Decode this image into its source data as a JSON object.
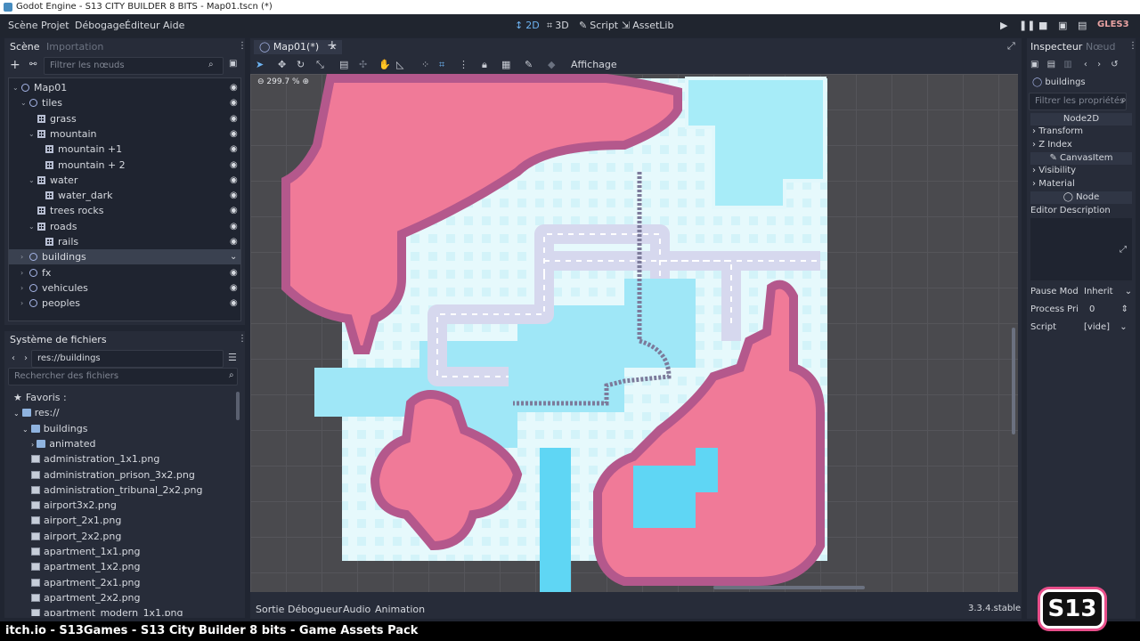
{
  "window": {
    "title": "Godot Engine - S13 CITY BUILDER 8 BITS - Map01.tscn (*)"
  },
  "menu": {
    "items": [
      "Scène",
      "Projet",
      "Débogage",
      "Éditeur",
      "Aide"
    ]
  },
  "modes": {
    "m2d": "2D",
    "m3d": "3D",
    "script": "Script",
    "assetlib": "AssetLib"
  },
  "renderer": "GLES3",
  "scene_dock": {
    "tab_active": "Scène",
    "tab_inactive": "Importation",
    "filter_placeholder": "Filtrer les nœuds",
    "tree": [
      {
        "label": "Map01",
        "type": "node2d",
        "depth": 0,
        "arrow": "open"
      },
      {
        "label": "tiles",
        "type": "node2d",
        "depth": 1,
        "arrow": "open"
      },
      {
        "label": "grass",
        "type": "tilemap",
        "depth": 2,
        "arrow": "none"
      },
      {
        "label": "mountain",
        "type": "tilemap",
        "depth": 2,
        "arrow": "open"
      },
      {
        "label": "mountain +1",
        "type": "tilemap",
        "depth": 3,
        "arrow": "none"
      },
      {
        "label": "mountain + 2",
        "type": "tilemap",
        "depth": 3,
        "arrow": "none"
      },
      {
        "label": "water",
        "type": "tilemap",
        "depth": 2,
        "arrow": "open"
      },
      {
        "label": "water_dark",
        "type": "tilemap",
        "depth": 3,
        "arrow": "none"
      },
      {
        "label": "trees rocks",
        "type": "tilemap",
        "depth": 2,
        "arrow": "none"
      },
      {
        "label": "roads",
        "type": "tilemap",
        "depth": 2,
        "arrow": "open"
      },
      {
        "label": "rails",
        "type": "tilemap",
        "depth": 3,
        "arrow": "none"
      },
      {
        "label": "buildings",
        "type": "node2d",
        "depth": 1,
        "arrow": "closed",
        "selected": true
      },
      {
        "label": "fx",
        "type": "node2d",
        "depth": 1,
        "arrow": "closed"
      },
      {
        "label": "vehicules",
        "type": "node2d",
        "depth": 1,
        "arrow": "closed"
      },
      {
        "label": "peoples",
        "type": "node2d",
        "depth": 1,
        "arrow": "closed"
      }
    ]
  },
  "filesystem": {
    "title": "Système de fichiers",
    "path": "res://buildings",
    "search_placeholder": "Rechercher des fichiers",
    "entries": [
      {
        "label": "Favoris :",
        "kind": "fav",
        "depth": 0
      },
      {
        "label": "res://",
        "kind": "folder",
        "depth": 0
      },
      {
        "label": "buildings",
        "kind": "folder",
        "depth": 1
      },
      {
        "label": "animated",
        "kind": "folder",
        "depth": 2
      },
      {
        "label": "administration_1x1.png",
        "kind": "img",
        "depth": 2
      },
      {
        "label": "administration_prison_3x2.png",
        "kind": "img",
        "depth": 2
      },
      {
        "label": "administration_tribunal_2x2.png",
        "kind": "img",
        "depth": 2
      },
      {
        "label": "airport3x2.png",
        "kind": "img",
        "depth": 2
      },
      {
        "label": "airport_2x1.png",
        "kind": "img",
        "depth": 2
      },
      {
        "label": "airport_2x2.png",
        "kind": "img",
        "depth": 2
      },
      {
        "label": "apartment_1x1.png",
        "kind": "img",
        "depth": 2
      },
      {
        "label": "apartment_1x2.png",
        "kind": "img",
        "depth": 2
      },
      {
        "label": "apartment_2x1.png",
        "kind": "img",
        "depth": 2
      },
      {
        "label": "apartment_2x2.png",
        "kind": "img",
        "depth": 2
      },
      {
        "label": "apartment_modern_1x1.png",
        "kind": "img",
        "depth": 2
      }
    ]
  },
  "editor": {
    "tab": "Map01(*)",
    "view_menu": "Affichage",
    "zoom": "299.7 %",
    "bottom_tabs": [
      "Sortie",
      "Débogueur",
      "Audio",
      "Animation"
    ],
    "version": "3.3.4.stable"
  },
  "inspector": {
    "tab_active": "Inspecteur",
    "tab_inactive": "Nœud",
    "object": "buildings",
    "filter_placeholder": "Filtrer les propriétés",
    "section_node2d": "Node2D",
    "transform": "Transform",
    "z_index": "Z Index",
    "section_canvasitem": "CanvasItem",
    "visibility": "Visibility",
    "material": "Material",
    "section_node": "Node",
    "editor_description": "Editor Description",
    "pause_mode_label": "Pause Mod",
    "pause_mode_value": "Inherit",
    "process_priority_label": "Process Pri",
    "process_priority_value": "0",
    "script_label": "Script",
    "script_value": "[vide]"
  },
  "banner": {
    "text": "itch.io - S13Games - S13 City Builder 8 bits - Game Assets Pack",
    "logo": "S13"
  },
  "colors": {
    "accent": "#6db3f2",
    "mountain": "#f07a98",
    "mountain_edge": "#b4588c",
    "water": "#5fd6f4",
    "grass": "#d9f6fb",
    "road": "#d6d8ee",
    "viewport_bg": "#4a4a4e"
  }
}
